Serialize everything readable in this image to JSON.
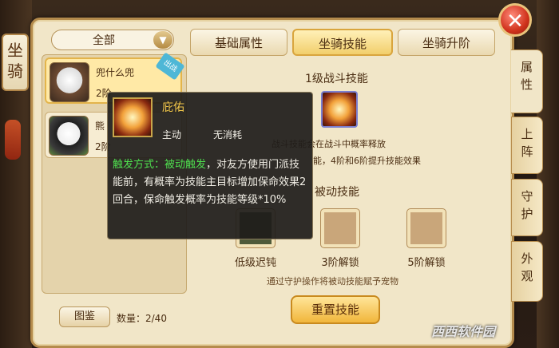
{
  "panel_title": [
    "坐",
    "骑"
  ],
  "filter": {
    "value": "全部"
  },
  "pets": [
    {
      "name": "兜什么兜",
      "level": "2阶",
      "tag": "出战"
    },
    {
      "name": "熊",
      "level": "2阶"
    }
  ],
  "tabs": [
    "基础属性",
    "坐骑技能",
    "坐骑升阶"
  ],
  "active_tab": 1,
  "side_tabs": [
    {
      "label": [
        "属",
        "性"
      ]
    },
    {
      "label": [
        "上",
        "阵"
      ]
    },
    {
      "label": [
        "守",
        "护"
      ]
    },
    {
      "label": [
        "外",
        "观"
      ]
    }
  ],
  "battle_skill": {
    "title": "1级战斗技能",
    "desc_line1": "战斗技能会在战斗中概率释放",
    "desc_line2": "能，4阶和6阶提升技能效果"
  },
  "passive": {
    "title": "被动技能",
    "slots": [
      {
        "label": "低级迟钝"
      },
      {
        "label": "3阶解锁"
      },
      {
        "label": "5阶解锁"
      }
    ],
    "note": "通过守护操作将被动技能赋予宠物"
  },
  "buttons": {
    "reset": "重置技能",
    "atlas": "图鉴",
    "close": "✕"
  },
  "count": "数量：2/40",
  "tooltip": {
    "name": "庇佑",
    "type": "主动",
    "cost": "无消耗",
    "trigger_label": "触发方式：被动触发",
    "body": "，对友方使用门派技能前，有概率为技能主目标增加保命效果2回合，保命触发概率为技能等级*10%"
  },
  "watermark": "西西软件园"
}
